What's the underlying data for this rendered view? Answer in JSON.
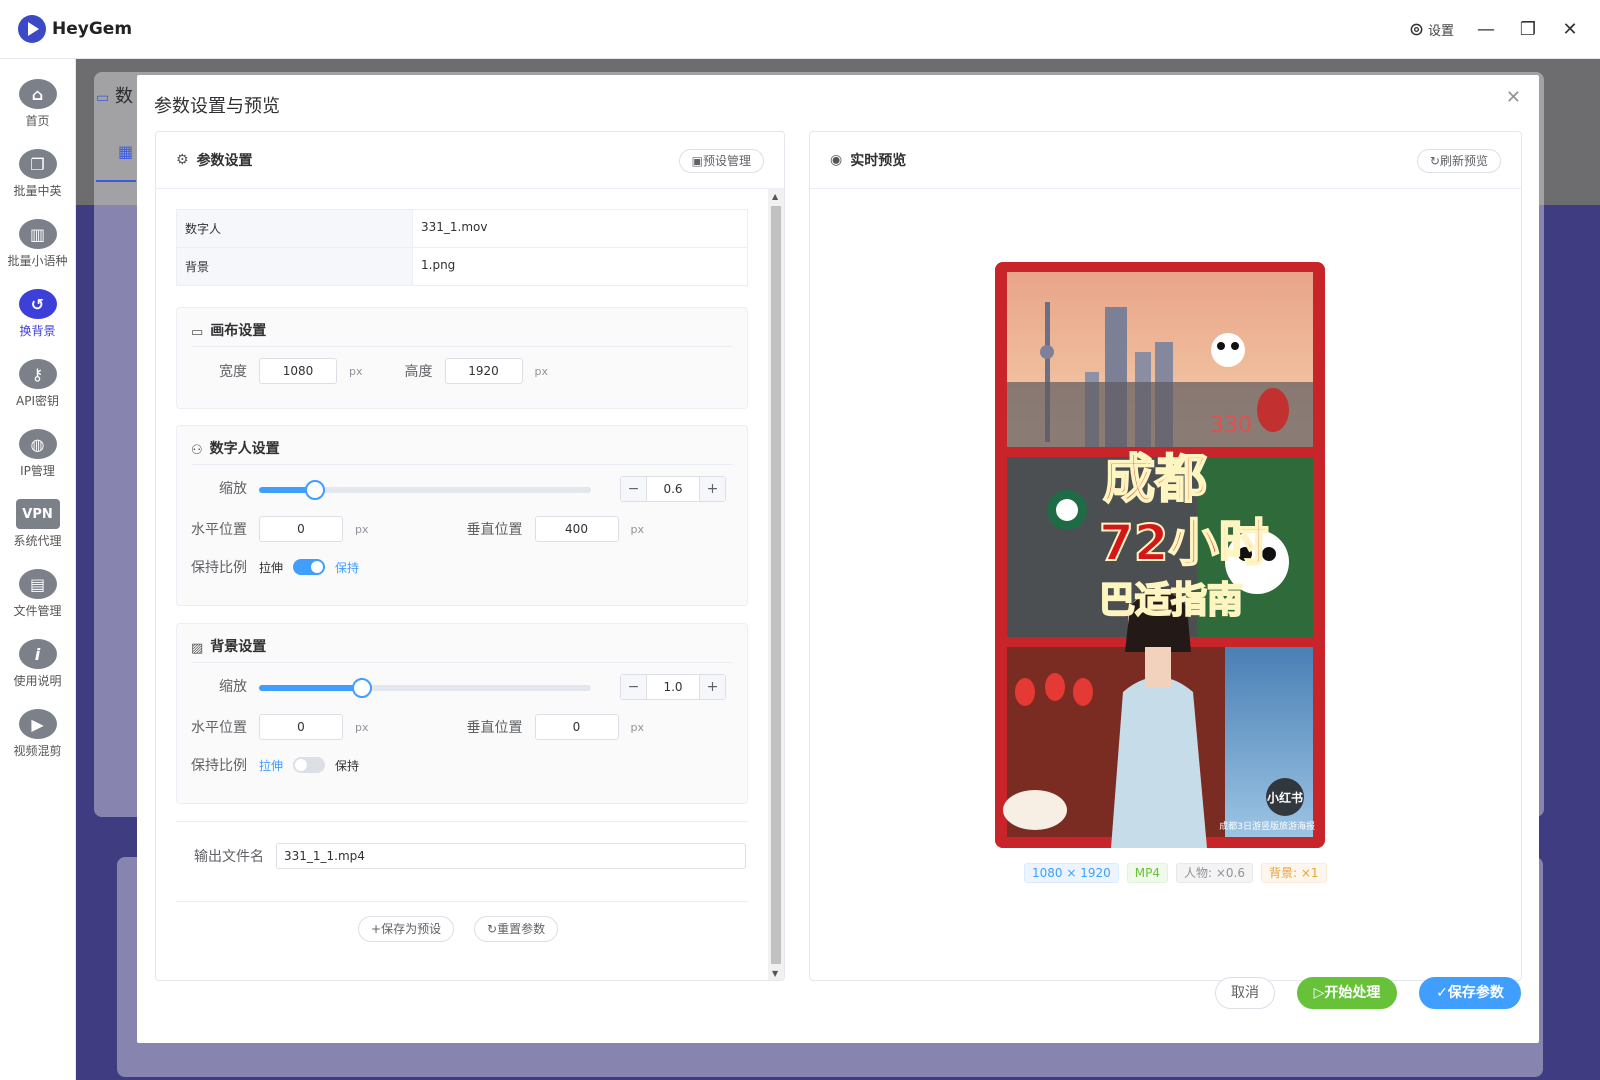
{
  "app": {
    "name": "HeyGem",
    "settings_label": "设置"
  },
  "sidebar": {
    "items": [
      {
        "label": "首页",
        "icon": "home-icon"
      },
      {
        "label": "批量中英",
        "icon": "copy-icon"
      },
      {
        "label": "批量小语种",
        "icon": "slides-icon"
      },
      {
        "label": "换背景",
        "icon": "undo-icon",
        "active": true
      },
      {
        "label": "API密钥",
        "icon": "key-icon"
      },
      {
        "label": "IP管理",
        "icon": "globe-icon"
      },
      {
        "label": "系统代理",
        "icon": "vpn-icon",
        "badge": "VPN"
      },
      {
        "label": "文件管理",
        "icon": "file-icon"
      },
      {
        "label": "使用说明",
        "icon": "info-icon"
      },
      {
        "label": "视频混剪",
        "icon": "video-edit-icon"
      }
    ]
  },
  "background_page": {
    "title_fragment": "数"
  },
  "dialog": {
    "title": "参数设置与预览",
    "left": {
      "title": "参数设置",
      "preset_button": "预设管理",
      "info": [
        {
          "key": "数字人",
          "value": "331_1.mov"
        },
        {
          "key": "背景",
          "value": "1.png"
        }
      ],
      "canvas": {
        "title": "画布设置",
        "width_label": "宽度",
        "width": "1080",
        "height_label": "高度",
        "height": "1920",
        "unit": "px"
      },
      "avatar": {
        "title": "数字人设置",
        "scale_label": "缩放",
        "scale": "0.6",
        "scale_fraction": 0.6,
        "h_label": "水平位置",
        "h": "0",
        "v_label": "垂直位置",
        "v": "400",
        "ratio_label": "保持比例",
        "stretch": "拉伸",
        "keep": "保持",
        "keep_on": true,
        "unit": "px"
      },
      "background": {
        "title": "背景设置",
        "scale_label": "缩放",
        "scale": "1.0",
        "scale_fraction": 1.0,
        "h_label": "水平位置",
        "h": "0",
        "v_label": "垂直位置",
        "v": "0",
        "ratio_label": "保持比例",
        "stretch": "拉伸",
        "keep": "保持",
        "keep_on": false,
        "unit": "px"
      },
      "output_label": "输出文件名",
      "output_value": "331_1_1.mp4",
      "save_preset": "保存为预设",
      "reset": "重置参数"
    },
    "right": {
      "title": "实时预览",
      "refresh": "刷新预览",
      "poster": {
        "headline_1": "成都",
        "headline_2": "72小时",
        "headline_3": "巴适指南",
        "badge": "小红书",
        "caption": "成都3日游竖版旅游海报",
        "number": "330"
      },
      "tags": [
        "1080 × 1920",
        "MP4",
        "人物: ×0.6",
        "背景: ×1"
      ]
    },
    "buttons": {
      "cancel": "取消",
      "start": "开始处理",
      "save": "保存参数"
    }
  }
}
